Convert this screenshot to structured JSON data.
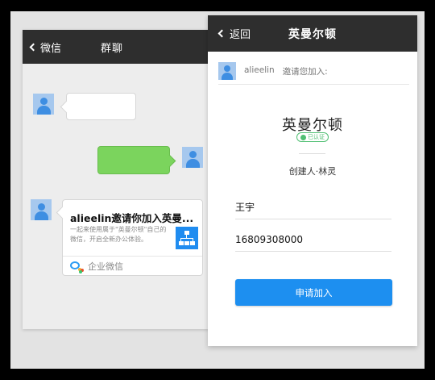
{
  "chat": {
    "back_label": "微信",
    "title": "群聊",
    "invite_card": {
      "title": "alieelin邀请你加入英曼...",
      "description": "一起来使用属于\"英曼尔顿\"自己的微信，开启全新办公体验。",
      "footer_label": "企业微信"
    }
  },
  "form": {
    "back_label": "返回",
    "title": "英曼尔顿",
    "inviter_name": "alieelin",
    "inviter_message": "邀请您加入:",
    "org_name": "英曼尔顿",
    "verified_label": "已认证",
    "creator": "创建人·林灵",
    "name_value": "王宇",
    "phone_value": "16809308000",
    "submit_label": "申请加入"
  },
  "colors": {
    "nav_bg": "#2e2e2e",
    "green_bubble": "#7bd45d",
    "primary_blue": "#1d8ff0",
    "verified_green": "#4fbf72"
  }
}
